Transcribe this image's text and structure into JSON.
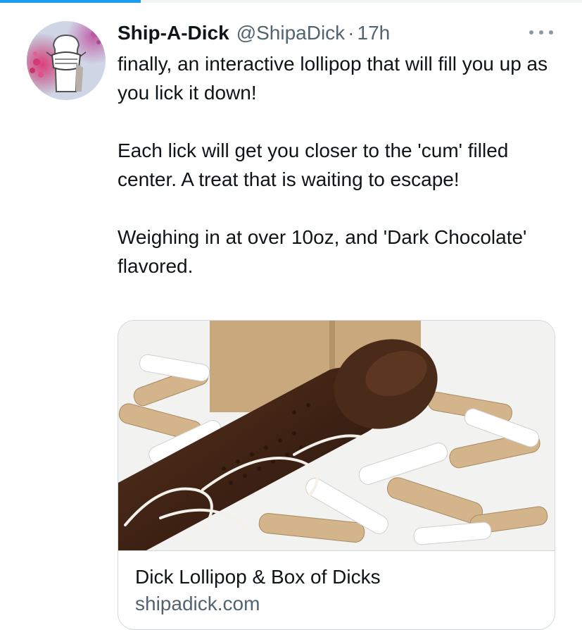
{
  "tweet": {
    "display_name": "Ship-A-Dick",
    "handle": "@ShipaDick",
    "separator": "·",
    "time": "17h",
    "more_icon": "more-horizontal-icon",
    "text": {
      "line1": "finally, an interactive lollipop that will fill you up as you lick it down!",
      "line2": "Each lick will get you closer to the 'cum' filled center. A treat that is waiting to escape!",
      "line3": "Weighing in at over 10oz, and 'Dark Chocolate' flavored."
    },
    "card": {
      "title": "Dick Lollipop & Box of Dicks",
      "domain": "shipadick.com"
    }
  },
  "colors": {
    "accent": "#1d9bf0",
    "text": "#0f1419",
    "secondary": "#536471",
    "border": "#cfd9de"
  }
}
